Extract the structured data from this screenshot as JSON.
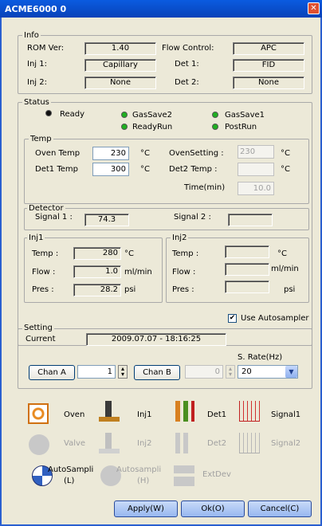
{
  "window": {
    "title": "ACME6000 0",
    "close_glyph": "✕"
  },
  "info": {
    "label": "Info",
    "rom_label": "ROM Ver:",
    "rom_value": "1.40",
    "flow_control_label": "Flow Control:",
    "flow_control_value": "APC",
    "inj1_label": "Inj 1:",
    "inj1_value": "Capillary",
    "det1_label": "Det 1:",
    "det1_value": "FID",
    "inj2_label": "Inj 2:",
    "inj2_value": "None",
    "det2_label": "Det 2:",
    "det2_value": "None"
  },
  "status": {
    "label": "Status",
    "ready": "Ready",
    "gassave2": "GasSave2",
    "gassave1": "GasSave1",
    "readyrun": "ReadyRun",
    "postrun": "PostRun",
    "led_colors": {
      "ready": "#101010",
      "on": "#1fb020",
      "off": "#8fd88f"
    }
  },
  "temp": {
    "label": "Temp",
    "oven_temp_label": "Oven Temp",
    "oven_temp_value": "230",
    "unit_c": "°C",
    "det1_temp_label": "Det1 Temp",
    "det1_temp_value": "300",
    "oven_setting_label": "OvenSetting :",
    "oven_setting_value": "230",
    "det2_temp_label": "Det2 Temp :",
    "det2_temp_value": "",
    "time_label": "Time(min)",
    "time_value": "10.0"
  },
  "detector": {
    "label": "Detector",
    "signal1_label": "Signal 1 :",
    "signal1_value": "74.3",
    "signal2_label": "Signal 2 :",
    "signal2_value": ""
  },
  "inj1": {
    "label": "Inj1",
    "temp_label": "Temp :",
    "temp_value": "280",
    "temp_unit": "°C",
    "flow_label": "Flow :",
    "flow_value": "1.0",
    "flow_unit": "ml/min",
    "pres_label": "Pres :",
    "pres_value": "28.2",
    "pres_unit": "psi"
  },
  "inj2": {
    "label": "Inj2",
    "temp_label": "Temp :",
    "temp_value": "",
    "temp_unit": "°C",
    "flow_label": "Flow :",
    "flow_value": "",
    "flow_unit": "ml/min",
    "pres_label": "Pres :",
    "pres_value": "",
    "pres_unit": "psi"
  },
  "autosampler": {
    "label": "Use Autosampler",
    "checked": true
  },
  "setting": {
    "label": "Setting",
    "current_label": "Current",
    "current_value": "2009.07.07 - 18:16:25",
    "chan_a_label": "Chan A",
    "chan_a_value": "1",
    "chan_b_label": "Chan B",
    "chan_b_value": "0",
    "srate_label": "S. Rate(Hz)",
    "srate_value": "20"
  },
  "toolbar": {
    "oven": "Oven",
    "inj1": "Inj1",
    "det1": "Det1",
    "signal1": "Signal1",
    "valve": "Valve",
    "inj2": "Inj2",
    "det2": "Det2",
    "signal2": "Signal2",
    "autosampler_l": "AutoSampli",
    "autosampler_l2": "(L)",
    "autosampler_h": "Autosampli",
    "autosampler_h2": "(H)",
    "extdev": "ExtDev"
  },
  "buttons": {
    "apply": "Apply(W)",
    "ok": "Ok(O)",
    "cancel": "Cancel(C)"
  }
}
